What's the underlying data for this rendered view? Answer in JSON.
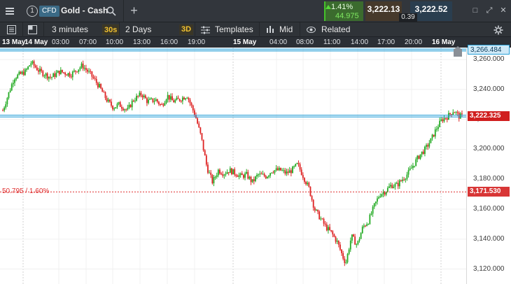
{
  "header": {
    "menu_icon": "hamburger-icon",
    "workspace_number": "1",
    "instrument_type": "CFD",
    "instrument_name": "Gold - Cash",
    "search_icon": "search-icon",
    "add_icon": "plus-icon",
    "change_percent": "1.41%",
    "change_value": "44.975",
    "change_direction": "up",
    "change_color": "#45c32a",
    "sell_price": "3,222.13",
    "buy_price": "3,222.52",
    "spread": "0.39",
    "window_controls": [
      "restore-icon",
      "expand-icon",
      "close-icon"
    ],
    "window_glyphs": [
      "□",
      "⤢",
      "✕"
    ]
  },
  "toolbar": {
    "layout_icon": "panel-icon",
    "grid_icon": "grid-icon",
    "interval": "3 minutes",
    "interval_badge": "30s",
    "period": "2 Days",
    "chart_mode_badge": "3D",
    "templates_label": "Templates",
    "price_mode_label": "Mid",
    "related_label": "Related",
    "settings_icon": "gear-icon"
  },
  "time_axis": {
    "labels": [
      "13 May",
      "14 May",
      "03:00",
      "07:00",
      "10:00",
      "13:00",
      "16:00",
      "19:00",
      "15 May",
      "04:00",
      "08:00",
      "11:00",
      "14:00",
      "17:00",
      "20:00",
      "16 May"
    ]
  },
  "chart_data": {
    "type": "candlestick",
    "instrument": "Gold - Cash",
    "interval": "3 minutes",
    "ylim": [
      3110,
      3268
    ],
    "y_ticks": [
      "3,260.000",
      "3,240.000",
      "3,220.000",
      "3,200.000",
      "3,180.000",
      "3,160.000",
      "3,140.000",
      "3,120.000"
    ],
    "y_tick_values": [
      3260,
      3240,
      3220,
      3200,
      3180,
      3160,
      3140,
      3120
    ],
    "up_color": "#22aa22",
    "down_color": "#dd2222",
    "price_path": [
      [
        0,
        3226
      ],
      [
        4,
        3248
      ],
      [
        8,
        3252
      ],
      [
        10,
        3258
      ],
      [
        13,
        3252
      ],
      [
        17,
        3248
      ],
      [
        20,
        3252
      ],
      [
        24,
        3250
      ],
      [
        28,
        3256
      ],
      [
        31,
        3250
      ],
      [
        34,
        3242
      ],
      [
        37,
        3232
      ],
      [
        39,
        3228
      ],
      [
        41,
        3230
      ],
      [
        44,
        3226
      ],
      [
        46,
        3233
      ],
      [
        49,
        3237
      ],
      [
        51,
        3232
      ],
      [
        54,
        3233
      ],
      [
        56,
        3229
      ],
      [
        58,
        3236
      ],
      [
        60,
        3232
      ],
      [
        62,
        3233
      ],
      [
        65,
        3236
      ],
      [
        68,
        3222
      ],
      [
        70,
        3208
      ],
      [
        72,
        3188
      ],
      [
        74,
        3178
      ],
      [
        76,
        3186
      ],
      [
        78,
        3184
      ],
      [
        80,
        3186
      ],
      [
        82,
        3184
      ],
      [
        84,
        3182
      ],
      [
        86,
        3183
      ],
      [
        88,
        3178
      ],
      [
        90,
        3183
      ],
      [
        93,
        3182
      ],
      [
        95,
        3186
      ],
      [
        98,
        3186
      ],
      [
        100,
        3184
      ],
      [
        102,
        3186
      ],
      [
        104,
        3190
      ],
      [
        106,
        3182
      ],
      [
        108,
        3174
      ],
      [
        110,
        3160
      ],
      [
        112,
        3154
      ],
      [
        114,
        3148
      ],
      [
        116,
        3144
      ],
      [
        118,
        3138
      ],
      [
        120,
        3128
      ],
      [
        121,
        3124
      ],
      [
        123,
        3142
      ],
      [
        125,
        3136
      ],
      [
        127,
        3148
      ],
      [
        129,
        3152
      ],
      [
        131,
        3162
      ],
      [
        133,
        3170
      ],
      [
        135,
        3172
      ],
      [
        137,
        3176
      ],
      [
        139,
        3176
      ],
      [
        141,
        3180
      ],
      [
        143,
        3184
      ],
      [
        145,
        3190
      ],
      [
        147,
        3196
      ],
      [
        149,
        3200
      ],
      [
        151,
        3206
      ],
      [
        153,
        3214
      ],
      [
        155,
        3220
      ],
      [
        157,
        3222
      ],
      [
        159,
        3226
      ],
      [
        161,
        3222
      ],
      [
        162,
        3222
      ]
    ],
    "horizontal_lines": [
      {
        "value": 3266.484,
        "label": "3,266.484",
        "color": "#2aa1d8",
        "kind": "alert"
      },
      {
        "value": 3222.325,
        "label": "3,222.325",
        "color": "#2aa1d8",
        "kind": "current"
      },
      {
        "value": 3171.53,
        "label": "3,171.530",
        "color": "#e03030",
        "kind": "stop",
        "left_label": "50.795 / 1.60%"
      }
    ],
    "session_dividers": [
      "14 May",
      "15 May",
      "16 May"
    ]
  }
}
